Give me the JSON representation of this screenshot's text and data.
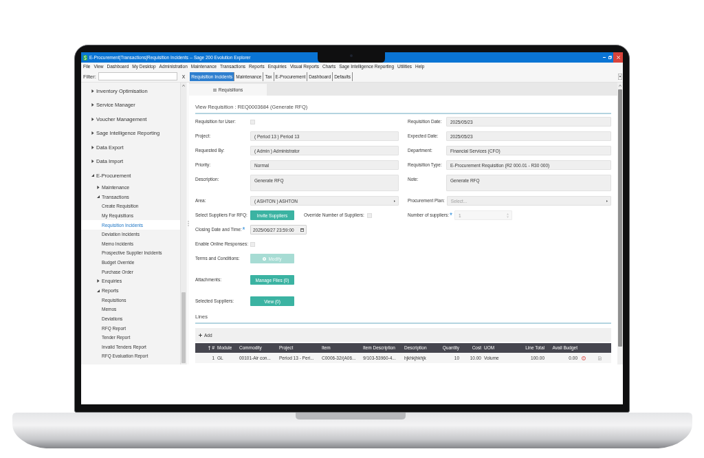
{
  "window": {
    "title": "E-Procurement|Transactions|Requisition Incidents -- Sage 200 Evolution Explorer"
  },
  "menu_bar": [
    "File",
    "View",
    "Dashboard",
    "My Desktop",
    "Administration",
    "Maintenance",
    "Transactions",
    "Reports",
    "Enquiries",
    "Visual Reports",
    "Charts",
    "Sage Intelligence Reporting",
    "Utilities",
    "Help"
  ],
  "toolbar": {
    "filter_label": "Filter:",
    "clear_label": "x",
    "tabs": [
      {
        "label": "Requisition Incidents",
        "selected": true
      },
      {
        "label": "Maintenance",
        "selected": false
      },
      {
        "label": "Tax",
        "selected": false
      },
      {
        "label": "E-Procurement",
        "selected": false
      },
      {
        "label": "Dashboard",
        "selected": false
      },
      {
        "label": "Defaults",
        "selected": false
      }
    ]
  },
  "sidebar": {
    "items": [
      {
        "label": "Inventory Optimisation",
        "expanded": false,
        "selected": false
      },
      {
        "label": "Service Manager",
        "expanded": false,
        "selected": false
      },
      {
        "label": "Voucher Management",
        "expanded": false,
        "selected": false
      },
      {
        "label": "Sage Intelligence Reporting",
        "expanded": false,
        "selected": false
      },
      {
        "label": "Data Export",
        "expanded": false,
        "selected": false
      },
      {
        "label": "Data Import",
        "expanded": false,
        "selected": false
      },
      {
        "label": "E-Procurement",
        "expanded": true,
        "selected": false,
        "children": [
          {
            "label": "Maintenance",
            "expanded": false,
            "selected": false
          },
          {
            "label": "Transactions",
            "expanded": true,
            "selected": false,
            "children": [
              {
                "label": "Create Requisition",
                "selected": false
              },
              {
                "label": "My Requisitions",
                "selected": false
              },
              {
                "label": "Requisition Incidents",
                "selected": true
              },
              {
                "label": "Deviation Incidents",
                "selected": false
              },
              {
                "label": "Memo Incidents",
                "selected": false
              },
              {
                "label": "Prospective Supplier Incidents",
                "selected": false
              },
              {
                "label": "Budget Override",
                "selected": false
              },
              {
                "label": "Purchase Order",
                "selected": false
              }
            ]
          },
          {
            "label": "Enquiries",
            "expanded": false,
            "selected": false
          },
          {
            "label": "Reports",
            "expanded": true,
            "selected": false,
            "children": [
              {
                "label": "Requisitions",
                "selected": false
              },
              {
                "label": "Memos",
                "selected": false
              },
              {
                "label": "Deviations",
                "selected": false
              },
              {
                "label": "RFQ Report",
                "selected": false
              },
              {
                "label": "Tender Report",
                "selected": false
              },
              {
                "label": "Invalid Tenders Report",
                "selected": false
              },
              {
                "label": "RFQ Evaluation Report",
                "selected": false
              }
            ]
          }
        ]
      }
    ]
  },
  "document_tabs": [
    {
      "label": "Requisitions",
      "selected": true
    }
  ],
  "form": {
    "title": "View Requisition : REQ0003684 (Generate RFQ)",
    "rows": [
      {
        "left": {
          "kind": "checkbox",
          "label": "Requisition for User:",
          "checked": false
        },
        "right": {
          "kind": "text",
          "label": "Requisition Date:",
          "value": "2025/05/23"
        }
      },
      {
        "left": {
          "kind": "text",
          "label": "Project:",
          "value": "( Period 13 ) Period 13"
        },
        "right": {
          "kind": "text",
          "label": "Expected Date:",
          "value": "2025/05/23"
        }
      },
      {
        "left": {
          "kind": "text",
          "label": "Requested By:",
          "value": "( Admin ) Administrator"
        },
        "right": {
          "kind": "text",
          "label": "Department:",
          "value": "Financial Services (CFO)"
        }
      },
      {
        "left": {
          "kind": "text",
          "label": "Priority:",
          "value": "Normal"
        },
        "right": {
          "kind": "text",
          "label": "Requisition Type:",
          "value": "E-Procurement Requisition (R2 000.01 - R30 000)"
        }
      },
      {
        "left": {
          "kind": "textarea",
          "label": "Description:",
          "value": "Generate RFQ"
        },
        "right": {
          "kind": "textarea",
          "label": "Note:",
          "value": "Generate RFQ"
        }
      },
      {
        "left": {
          "kind": "select",
          "label": "Area:",
          "value": "( ASHTON ) ASHTON"
        },
        "right": {
          "kind": "select",
          "label": "Procurement Plan:",
          "placeholder": "Select..."
        }
      },
      {
        "left": {
          "kind": "button",
          "label": "Select Suppliers For RFQ:",
          "button": "Invite Suppliers",
          "disabled": false,
          "option": {
            "label": "Override Number of Suppliers:",
            "checked": false
          }
        },
        "right": {
          "kind": "number",
          "label": "Number of suppliers:",
          "required_mark": "*",
          "value": "1",
          "disabled": true
        }
      },
      {
        "left": {
          "kind": "date",
          "label": "Closing Date and Time:",
          "required_mark": "*",
          "value": "2025/06/27 23:59:00"
        }
      },
      {
        "left": {
          "kind": "checkbox",
          "label": "Enable Online Responses:",
          "checked": false
        }
      }
    ],
    "action_rows": [
      {
        "kind": "iconbutton",
        "label": "Terms and Conditions:",
        "button": "Modify",
        "disabled": true
      },
      {
        "kind": "button",
        "label": "Attachments:",
        "button": "Manage Files (0)",
        "disabled": false
      },
      {
        "kind": "button",
        "label": "Selected Suppliers:",
        "button": "View (0)",
        "disabled": false
      }
    ]
  },
  "lines": {
    "title": "Lines",
    "add_label": "Add",
    "columns": [
      {
        "label": "#",
        "kind": "number",
        "sorted": true
      },
      {
        "label": "Module",
        "kind": "text",
        "sorted": false
      },
      {
        "label": "Commodity",
        "kind": "text",
        "sorted": false
      },
      {
        "label": "Project",
        "kind": "text",
        "sorted": false
      },
      {
        "label": "Item",
        "kind": "text",
        "sorted": false
      },
      {
        "label": "Item Description",
        "kind": "text",
        "sorted": false
      },
      {
        "label": "Description",
        "kind": "text",
        "sorted": false
      },
      {
        "label": "Quantity",
        "kind": "number",
        "sorted": false
      },
      {
        "label": "Cost",
        "kind": "number",
        "sorted": false
      },
      {
        "label": "UOM",
        "kind": "text",
        "sorted": false
      },
      {
        "label": "Line Total",
        "kind": "number",
        "sorted": false
      },
      {
        "label": "Avail Budget",
        "kind": "number",
        "sorted": false
      }
    ],
    "rows": [
      {
        "cells": [
          "1",
          "GL",
          "00101-Air con...",
          "Period 13 - Peri...",
          "C0006-32/(A06...",
          "9/103-53960-4...",
          "hjkhkjhkhjk",
          "10",
          "10.00",
          "Volume",
          "100.00",
          "0.00"
        ],
        "budget_alert": true
      }
    ]
  }
}
